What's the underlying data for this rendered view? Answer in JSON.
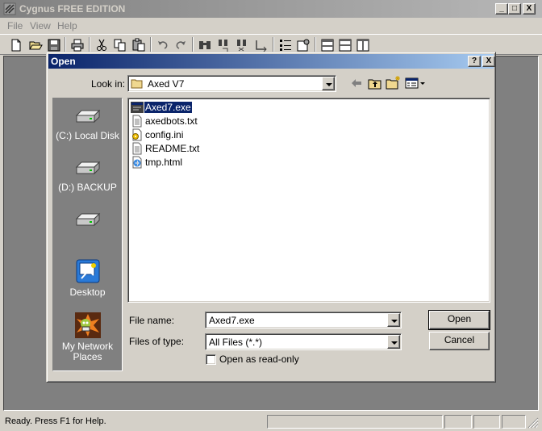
{
  "app": {
    "title": "Cygnus FREE EDITION",
    "menu": [
      "File",
      "View",
      "Help"
    ],
    "caption_buttons": [
      "_",
      "□",
      "X"
    ],
    "toolbar_icons": [
      "new-file-icon",
      "open-folder-icon",
      "save-icon",
      "print-icon",
      "cut-icon",
      "copy-icon",
      "paste-icon",
      "undo-icon",
      "redo-icon",
      "find-icon",
      "find-replace-icon",
      "replace-icon",
      "goto-line-icon",
      "bullet-list-icon",
      "properties-icon",
      "window-top-icon",
      "window-split-icon",
      "window-columns-icon"
    ]
  },
  "status": {
    "text": "Ready.  Press F1 for Help."
  },
  "dialog": {
    "title": "Open",
    "help_btn": "?",
    "close_btn": "X",
    "look_in_label": "Look in:",
    "look_in_value": "Axed V7",
    "places": [
      {
        "label": "(C:) Local Disk",
        "icon": "hard-drive-icon"
      },
      {
        "label": "(D:) BACKUP",
        "icon": "hard-drive-icon"
      },
      {
        "label": "",
        "icon": "hard-drive-icon"
      },
      {
        "label": "Desktop",
        "icon": "desktop-icon"
      },
      {
        "label": "My Network Places",
        "icon": "network-places-icon"
      }
    ],
    "files": [
      {
        "name": "Axed7.exe",
        "icon": "exe-icon",
        "selected": true
      },
      {
        "name": "axedbots.txt",
        "icon": "text-file-icon",
        "selected": false
      },
      {
        "name": "config.ini",
        "icon": "ini-file-icon",
        "selected": false
      },
      {
        "name": "README.txt",
        "icon": "text-file-icon",
        "selected": false
      },
      {
        "name": "tmp.html",
        "icon": "html-file-icon",
        "selected": false
      }
    ],
    "file_name_label": "File name:",
    "file_name_value": "Axed7.exe",
    "file_type_label": "Files of type:",
    "file_type_value": "All Files (*.*)",
    "readonly_label": "Open as read-only",
    "open_btn": "Open",
    "cancel_btn": "Cancel"
  }
}
